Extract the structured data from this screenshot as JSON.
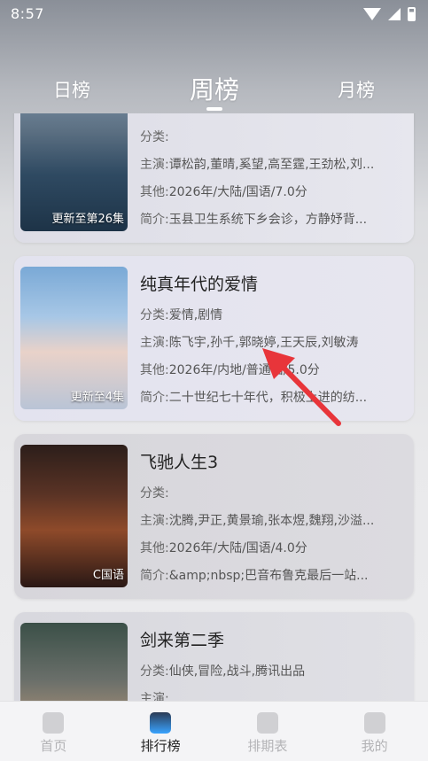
{
  "status_bar": {
    "time": "8:57"
  },
  "tabs": {
    "daily": "日榜",
    "weekly": "周榜",
    "monthly": "月榜"
  },
  "labels": {
    "category": "分类:",
    "cast": "主演:",
    "other": "其他:",
    "summary": "简介:"
  },
  "cards": [
    {
      "title": "",
      "category": "",
      "cast": "谭松韵,董晴,奚望,高至霆,王劲松,刘...",
      "other": "2026年/大陆/国语/7.0分",
      "summary": "玉县卫生系统下乡会诊，方静妤背...",
      "badge": "更新至第26集"
    },
    {
      "title": "纯真年代的爱情",
      "category": "爱情,剧情",
      "cast": "陈飞宇,孙千,郭晓婷,王天辰,刘敏涛",
      "other": "2026年/内地/普通话/5.0分",
      "summary": "二十世纪七十年代，积极上进的纺...",
      "badge": "更新至4集"
    },
    {
      "title": "飞驰人生3",
      "category": "",
      "cast": "沈腾,尹正,黄景瑜,张本煜,魏翔,沙溢...",
      "other": "2026年/大陆/国语/4.0分",
      "summary": "&amp;nbsp;巴音布鲁克最后一站...",
      "badge": "C国语"
    },
    {
      "title": "剑来第二季",
      "category": "仙侠,冒险,战斗,腾讯出品",
      "cast": "",
      "other": "",
      "summary": "",
      "badge": ""
    }
  ],
  "bottom_nav": [
    {
      "label": "首页",
      "icon": "home-icon"
    },
    {
      "label": "排行榜",
      "icon": "ranking-icon"
    },
    {
      "label": "排期表",
      "icon": "calendar-icon"
    },
    {
      "label": "我的",
      "icon": "profile-icon"
    }
  ],
  "colors": {
    "active_nav": "#222222",
    "inactive_nav": "#b3b3b6",
    "annotation_arrow": "#e8353a"
  }
}
